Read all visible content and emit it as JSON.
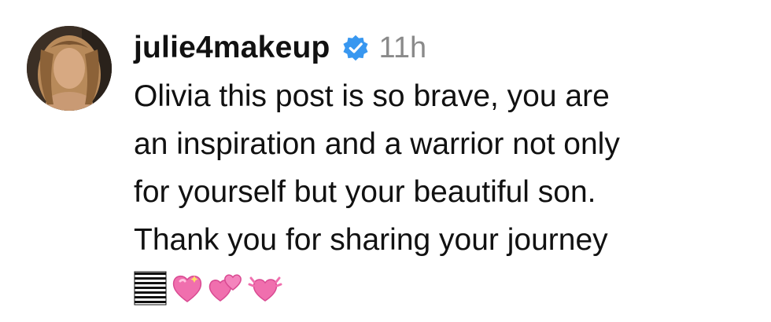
{
  "comment": {
    "username": "julie4makeup",
    "verified": true,
    "timestamp": "11h",
    "text_lines": [
      "Olivia this post is so brave, you are",
      "an inspiration and a warrior not only",
      "for yourself but your beautiful son.",
      "Thank you for sharing your journey"
    ],
    "emojis": [
      "striped-ribbon-emoji",
      "sparkling-heart-emoji",
      "two-hearts-emoji",
      "beating-heart-emoji"
    ]
  },
  "colors": {
    "verified_badge": "#3897f0",
    "timestamp": "#8a8a8a",
    "heart_pink": "#f06fae"
  }
}
